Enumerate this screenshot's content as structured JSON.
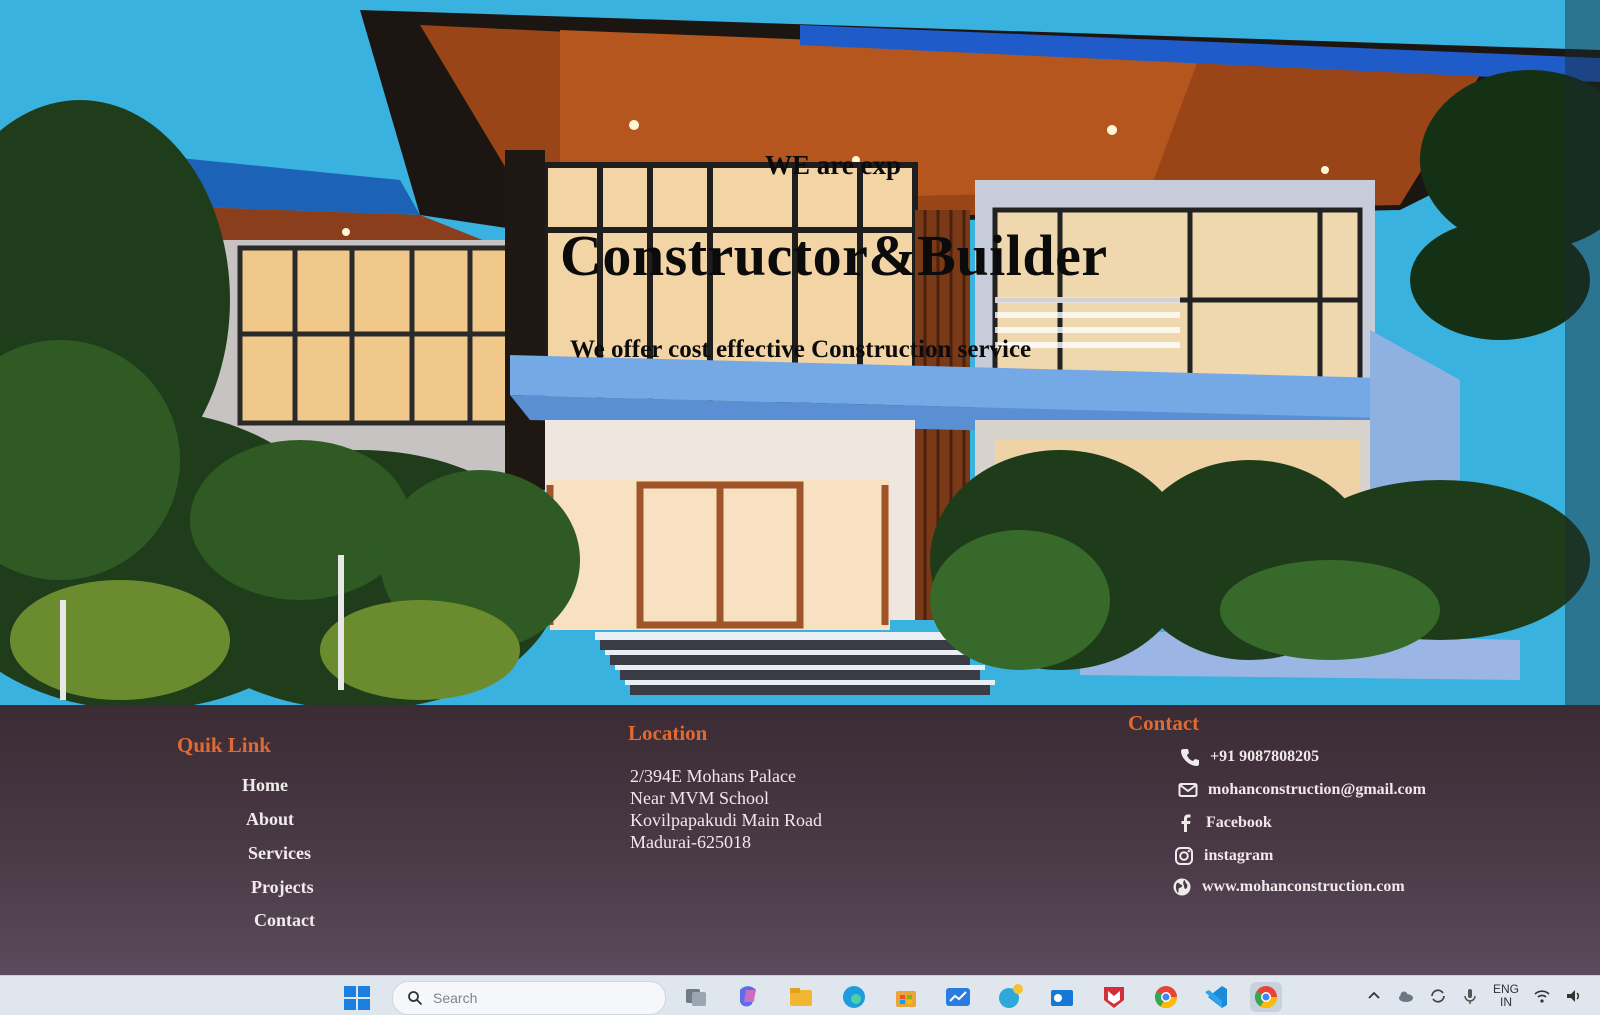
{
  "hero": {
    "tagline": "WE are exp",
    "title": "Constructor&Builder",
    "subtitle": "We offer cost effective Construction service"
  },
  "footer": {
    "quik_link": {
      "heading": "Quik Link",
      "items": [
        "Home",
        "About",
        "Services",
        "Projects",
        "Contact"
      ]
    },
    "location": {
      "heading": "Location",
      "lines": [
        "2/394E Mohans Palace",
        "Near MVM School",
        "Kovilpapakudi Main Road",
        "Madurai-625018"
      ]
    },
    "contact": {
      "heading": "Contact",
      "phone": "+91 9087808205",
      "email": "mohanconstruction@gmail.com",
      "facebook": "Facebook",
      "instagram": "instagram",
      "website": "www.mohanconstruction.com"
    }
  },
  "taskbar": {
    "search_placeholder": "Search",
    "lang_top": "ENG",
    "lang_bottom": "IN"
  },
  "colors": {
    "heading_accent": "#e06a34",
    "footer_bg": "#4a3a47",
    "hero_text": "#0b0b0b"
  },
  "icons": {
    "phone": "phone-icon",
    "email": "mail-icon",
    "facebook": "facebook-icon",
    "instagram": "instagram-icon",
    "website": "globe-icon"
  }
}
